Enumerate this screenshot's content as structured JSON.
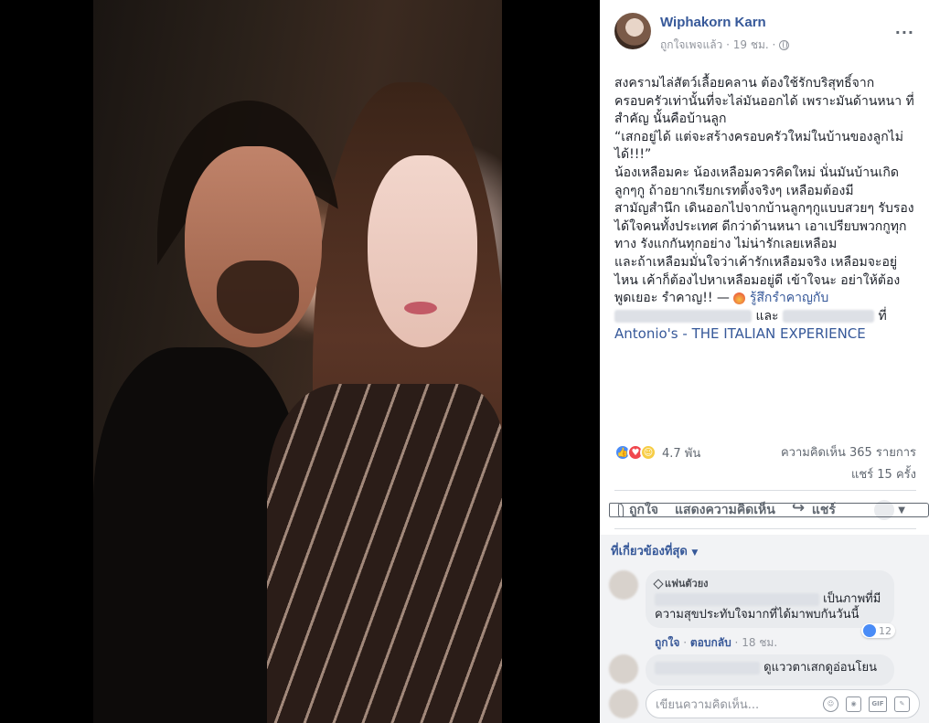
{
  "post": {
    "author": "Wiphakorn Karn",
    "meta_text": "ถูกใจเพจแล้ว · 19 ชม. ·",
    "more_label": "···",
    "paragraphs": [
      "สงครามไล่สัตว์เลื้อยคลาน ต้องใช้รักบริสุทธิ์จากครอบครัวเท่านั้นที่จะไล่มันออกได้ เพราะมันด้านหนา ที่สำคัญ นั้นคือบ้านลูก",
      "“เสกอยู่ได้ แต่จะสร้างครอบครัวใหม่ในบ้านของลูกไม่ได้!!!”",
      "น้องเหลือมคะ น้องเหลือมควรคิดใหม่ นั่นมันบ้านเกิดลูกๆกู ถ้าอยากเรียกเรทติ้งจริงๆ เหลือมต้องมีสามัญสำนึก เดินออกไปจากบ้านลูกๆกูแบบสวยๆ รับรอง ได้ใจคนทั้งประเทศ ดีกว่าด้านหนา เอาเปรียบพวกกูทุกทาง รังแกกันทุกอย่าง ไม่น่ารักเลยเหลือม",
      "และถ้าเหลือมมั่นใจว่าเค้ารักเหลือมจริง เหลือมจะอยู่ไหน เค้าก็ต้องไปหาเหลือมอยู่ดี เข้าใจนะ อย่าให้ต้องพูดเยอะ รำคาญ!! —"
    ],
    "feeling_text": "รู้สึกรำคาญกับ",
    "and_text": "และ",
    "at_text": "ที่",
    "place": "Antonio's - THE ITALIAN EXPERIENCE"
  },
  "stats": {
    "reactions_count": "4.7 พัน",
    "comments_count": "ความคิดเห็น 365 รายการ",
    "shares_count": "แชร์ 15 ครั้ง"
  },
  "actions": {
    "like": "ถูกใจ",
    "comment": "แสดงความคิดเห็น",
    "share": "แชร์"
  },
  "comments_section": {
    "sort_label": "ที่เกี่ยวข้องที่สุด",
    "comments": [
      {
        "badge": "แฟนตัวยง",
        "text_line1": "เป็นภาพที่มี",
        "text_line2": "ความสุขประทับใจมากที่ได้มาพบกันวันนี้",
        "like_label": "ถูกใจ",
        "reply_label": "ตอบกลับ",
        "time": "18 ชม.",
        "reactions": "12"
      },
      {
        "text_line1": "ดูแววตาเสกดูอ่อนโยน"
      }
    ],
    "write_placeholder": "เขียนความคิดเห็น..."
  },
  "write_tools": {
    "gif": "GIF"
  }
}
